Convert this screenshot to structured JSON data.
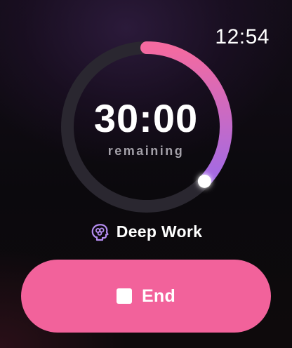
{
  "status_bar": {
    "time": "12:54"
  },
  "timer": {
    "value": "30:00",
    "caption": "remaining",
    "progress": 0.37,
    "colors": {
      "start": "#f46aa0",
      "end": "#a06ae6",
      "track": "#2a2730"
    }
  },
  "session": {
    "label": "Deep Work",
    "icon": "brain-icon",
    "icon_color": "#b48cf0"
  },
  "end_button": {
    "label": "End",
    "icon": "stop-icon",
    "color": "#f2629b"
  }
}
